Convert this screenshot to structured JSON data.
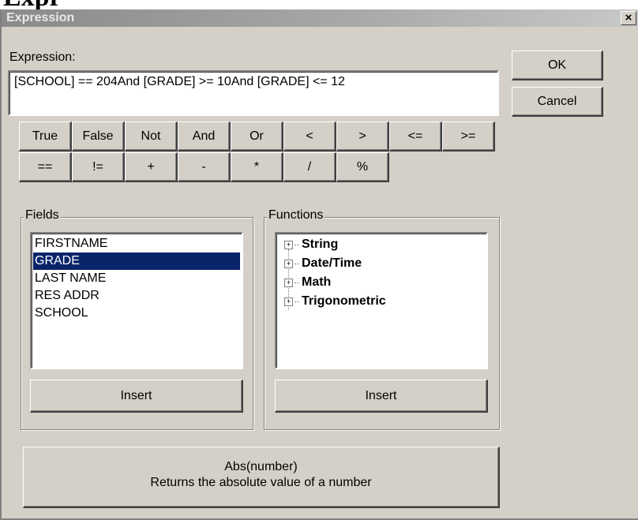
{
  "page_clip_text": "Expr",
  "window": {
    "title": "Expression",
    "close_glyph": "×"
  },
  "expression": {
    "label": "Expression:",
    "value": "[SCHOOL] == 204And [GRADE] >= 10And [GRADE] <= 12"
  },
  "dialog_buttons": {
    "ok": "OK",
    "cancel": "Cancel"
  },
  "operators_row1": [
    "True",
    "False",
    "Not",
    "And",
    "Or",
    "<",
    ">",
    "<=",
    ">="
  ],
  "operators_row2": [
    "==",
    "!=",
    "+",
    "-",
    "*",
    "/",
    "%"
  ],
  "fields": {
    "legend": "Fields",
    "items": [
      "FIRSTNAME",
      "GRADE",
      "LAST NAME",
      "RES ADDR",
      "SCHOOL"
    ],
    "selected": "GRADE",
    "insert_label": "Insert"
  },
  "functions": {
    "legend": "Functions",
    "items": [
      "String",
      "Date/Time",
      "Math",
      "Trigonometric"
    ],
    "expand_glyph": "+",
    "insert_label": "Insert"
  },
  "description": {
    "signature": "Abs(number)",
    "text": "Returns the absolute value of a number"
  }
}
